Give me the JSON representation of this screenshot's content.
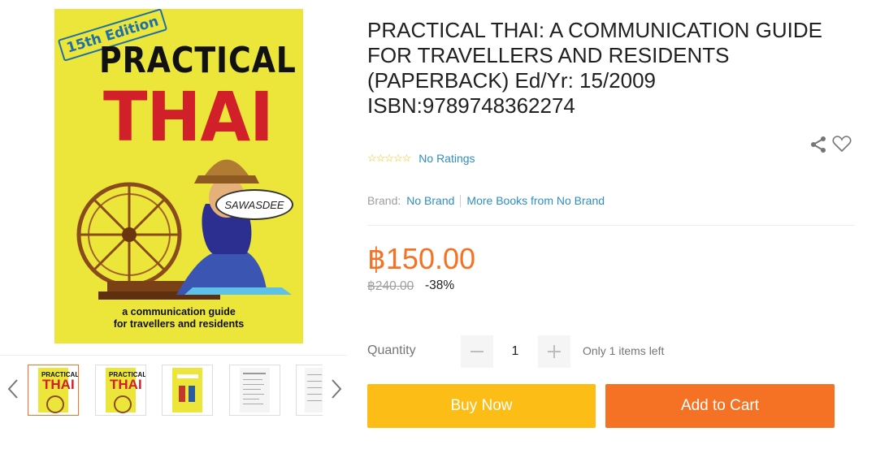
{
  "product": {
    "title": "PRACTICAL THAI: A COMMUNICATION GUIDE FOR TRAVELLERS AND RESIDENTS (PAPERBACK) Ed/Yr: 15/2009 ISBN:9789748362274",
    "cover": {
      "edition": "15th Edition",
      "title_line1": "PRACTICAL",
      "title_line2": "THAI",
      "bubble": "SAWASDEE",
      "subtitle_line1": "a communication guide",
      "subtitle_line2": "for travellers and residents"
    },
    "rating_stars": "☆☆☆☆☆",
    "rating_text": "No Ratings",
    "brand_label": "Brand:",
    "brand_name": "No Brand",
    "more_from_brand": "More Books from No Brand",
    "price": "฿150.00",
    "original_price": "฿240.00",
    "discount": "-38%",
    "quantity_label": "Quantity",
    "quantity_value": "1",
    "stock_text": "Only 1 items left",
    "buy_now": "Buy Now",
    "add_to_cart": "Add to Cart"
  },
  "gallery": {
    "thumbnail_count": 5,
    "active_index": 0
  },
  "colors": {
    "accent_orange": "#f57224",
    "buy_yellow": "#fbbd16",
    "link_blue": "#2f8ec2",
    "star_yellow": "#f9b90f",
    "cover_yellow": "#ece63a",
    "cover_red": "#d2202a"
  },
  "icons": [
    "chevron-left-icon",
    "chevron-right-icon",
    "share-icon",
    "heart-icon",
    "minus-icon",
    "plus-icon"
  ]
}
